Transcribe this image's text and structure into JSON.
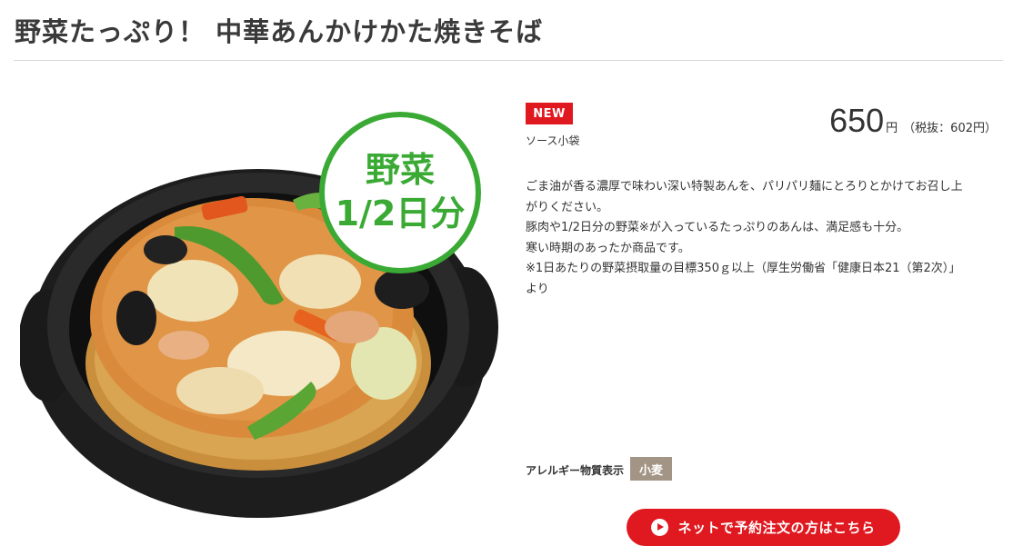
{
  "product": {
    "title": "野菜たっぷり！ 中華あんかけかた焼きそば",
    "badge_new": "NEW",
    "note": "ソース小袋",
    "price": "650",
    "price_unit": "円",
    "price_tax": "（税抜：602円）",
    "description": [
      "ごま油が香る濃厚で味わい深い特製あんを、パリパリ麺にとろりとかけてお召し上",
      "がりください。",
      "豚肉や1/2日分の野菜※が入っているたっぷりのあんは、満足感も十分。",
      "寒い時期のあったか商品です。",
      "※1日あたりの野菜摂取量の目標350ｇ以上（厚生労働省「健康日本21（第2次）」",
      "より"
    ],
    "allergy_label": "アレルギー物質表示",
    "allergens": [
      "小麦"
    ],
    "photo_badge": {
      "line1": "野菜",
      "line2": "1/2日分",
      "color": "#3aaa35"
    }
  },
  "order_button": {
    "label": "ネットで予約注文の方はこちら",
    "icon": "play-circle-icon",
    "color": "#e0181f"
  }
}
